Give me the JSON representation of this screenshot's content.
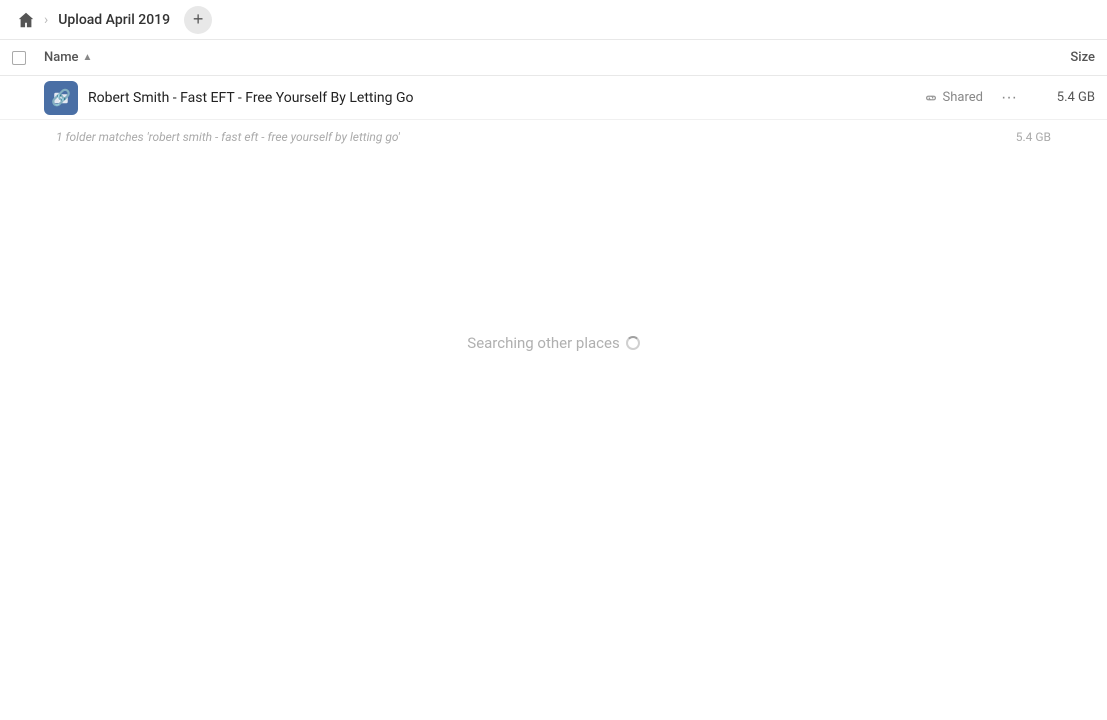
{
  "breadcrumb": {
    "home_label": "Home",
    "separator": "›",
    "current_folder": "Upload April 2019",
    "add_button_label": "+"
  },
  "column_headers": {
    "name_label": "Name",
    "sort_indicator": "▲",
    "size_label": "Size"
  },
  "file_row": {
    "name": "Robert Smith - Fast EFT - Free Yourself By Letting Go",
    "shared_label": "Shared",
    "more_icon": "···",
    "size": "5.4 GB"
  },
  "match_info": {
    "text": "1 folder matches 'robert smith - fast eft - free yourself by letting go'",
    "size": "5.4 GB"
  },
  "searching": {
    "text": "Searching other places"
  },
  "icons": {
    "home": "⌂",
    "link": "🔗"
  }
}
